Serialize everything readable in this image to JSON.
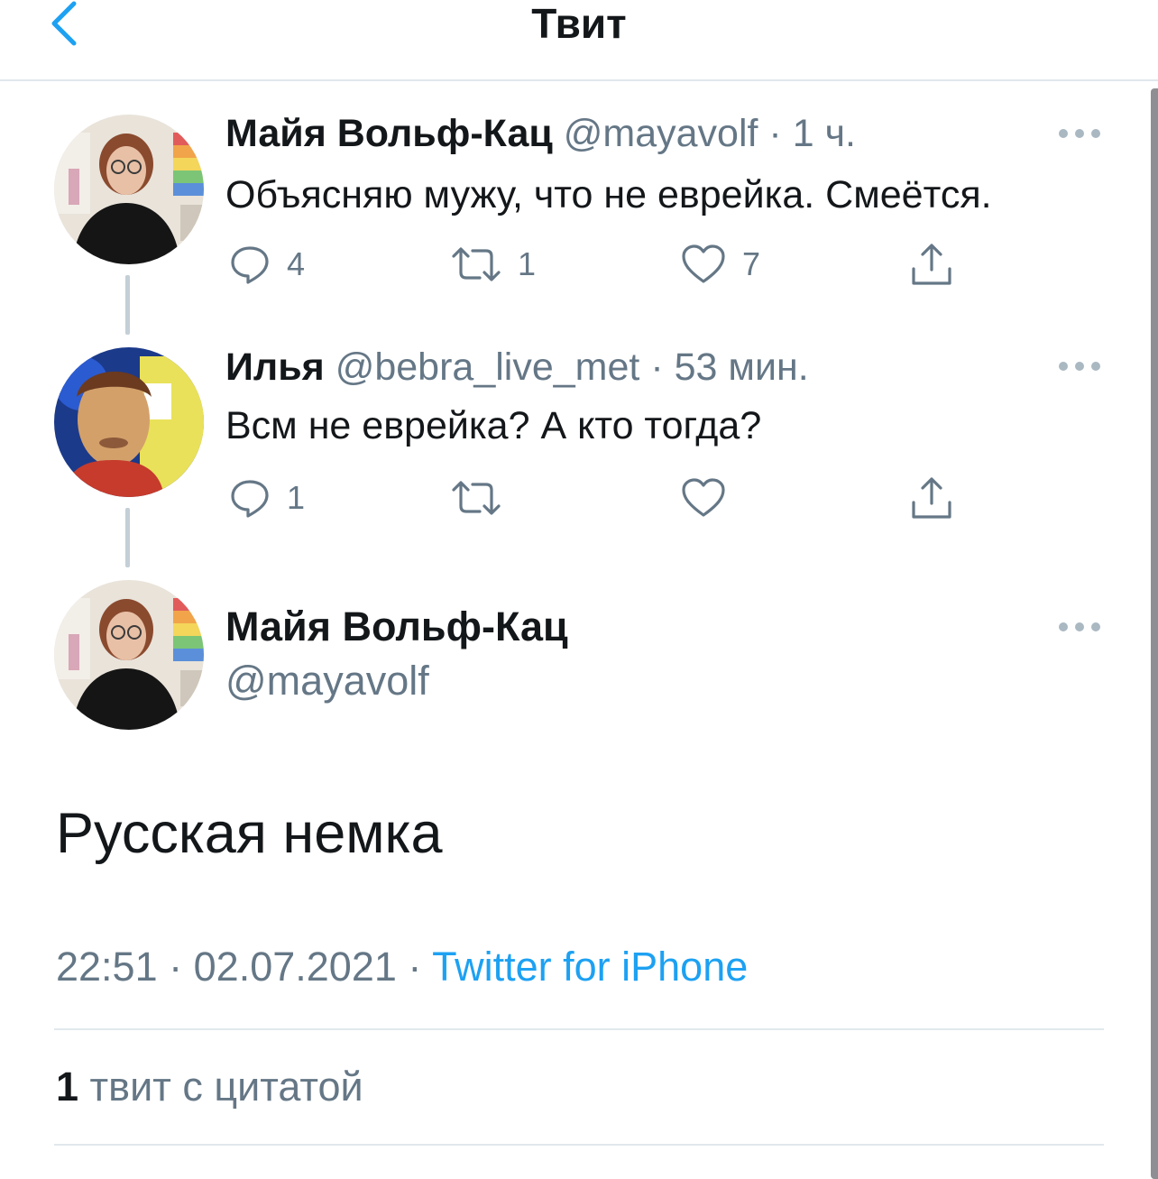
{
  "header": {
    "title": "Твит",
    "back_icon": "chevron-left-icon"
  },
  "colors": {
    "accent": "#1da1f2",
    "secondary_text": "#657786",
    "icon": "#657786",
    "divider": "#e1e8ed"
  },
  "thread": [
    {
      "name": "Майя Вольф-Кац",
      "handle": "@mayavolf",
      "separator": "·",
      "time": "1 ч.",
      "text": "Объясняю мужу, что не еврейка. Смеётся.",
      "reply_count": "4",
      "retweet_count": "1",
      "like_count": "7"
    },
    {
      "name": "Илья",
      "handle": "@bebra_live_met",
      "separator": "·",
      "time": "53 мин.",
      "text": "Всм не еврейка? А кто тогда?",
      "reply_count": "1",
      "retweet_count": "",
      "like_count": ""
    }
  ],
  "main_tweet": {
    "name": "Майя Вольф-Кац",
    "handle": "@mayavolf",
    "text": "Русская немка",
    "time": "22:51",
    "date": "02.07.2021",
    "separator": "·",
    "source": "Twitter for iPhone",
    "quote_count": "1",
    "quote_label": "твит с цитатой"
  }
}
